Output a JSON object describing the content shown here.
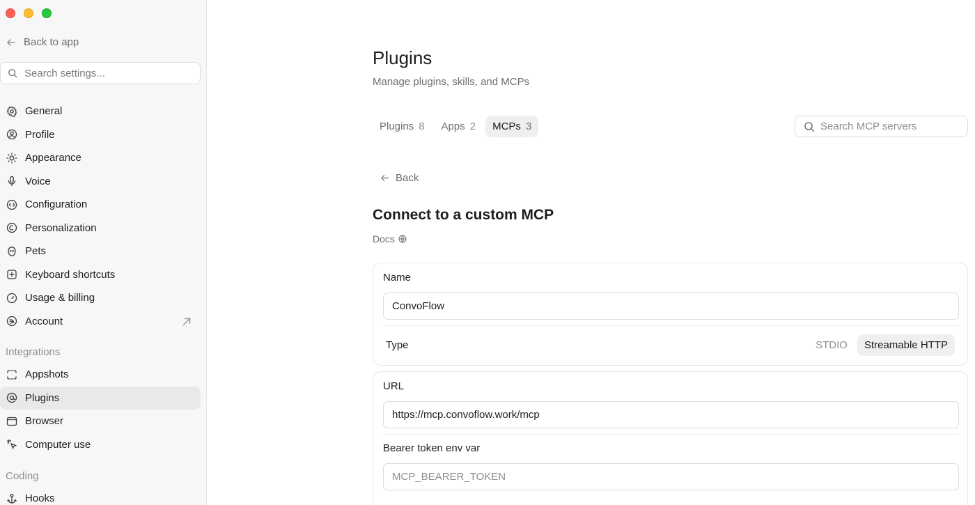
{
  "sidebar": {
    "back_label": "Back to app",
    "search_placeholder": "Search settings...",
    "items": [
      {
        "label": "General",
        "icon": "gear-icon"
      },
      {
        "label": "Profile",
        "icon": "person-circle-icon"
      },
      {
        "label": "Appearance",
        "icon": "sun-icon"
      },
      {
        "label": "Voice",
        "icon": "microphone-icon"
      },
      {
        "label": "Configuration",
        "icon": "config-icon"
      },
      {
        "label": "Personalization",
        "icon": "personalization-icon"
      },
      {
        "label": "Pets",
        "icon": "pet-icon"
      },
      {
        "label": "Keyboard shortcuts",
        "icon": "keyboard-icon"
      },
      {
        "label": "Usage & billing",
        "icon": "gauge-icon"
      },
      {
        "label": "Account",
        "icon": "account-icon"
      }
    ],
    "integrations_label": "Integrations",
    "integration_items": [
      {
        "label": "Appshots",
        "icon": "screenshot-frame-icon"
      },
      {
        "label": "Plugins",
        "icon": "at-icon"
      },
      {
        "label": "Browser",
        "icon": "browser-icon"
      },
      {
        "label": "Computer use",
        "icon": "cursor-click-icon"
      }
    ],
    "coding_label": "Coding",
    "coding_items": [
      {
        "label": "Hooks",
        "icon": "hook-icon"
      }
    ]
  },
  "main": {
    "title": "Plugins",
    "subtitle": "Manage plugins, skills, and MCPs",
    "tabs": [
      {
        "label": "Plugins",
        "count": "8"
      },
      {
        "label": "Apps",
        "count": "2"
      },
      {
        "label": "MCPs",
        "count": "3"
      }
    ],
    "search_placeholder": "Search MCP servers",
    "back_label": "Back",
    "section_title": "Connect to a custom MCP",
    "docs_label": "Docs",
    "form": {
      "name_label": "Name",
      "name_value": "ConvoFlow",
      "type_label": "Type",
      "type_options": [
        "STDIO",
        "Streamable HTTP"
      ],
      "type_selected": "Streamable HTTP",
      "url_label": "URL",
      "url_value": "https://mcp.convoflow.work/mcp",
      "bearer_label": "Bearer token env var",
      "bearer_placeholder": "MCP_BEARER_TOKEN"
    }
  }
}
